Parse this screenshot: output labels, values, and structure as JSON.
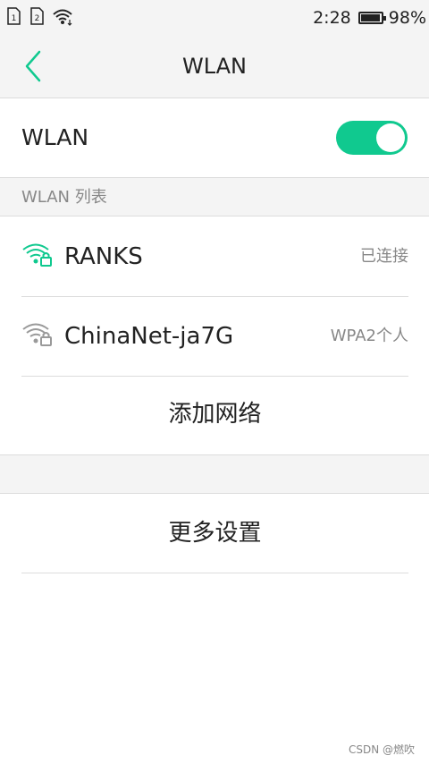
{
  "status_bar": {
    "sim1_label": "1",
    "sim2_label": "2",
    "time": "2:28",
    "battery_percent": "98%",
    "battery_level": 0.98
  },
  "header": {
    "title": "WLAN"
  },
  "wlan_toggle": {
    "label": "WLAN",
    "enabled": true
  },
  "list_section": {
    "title": "WLAN 列表"
  },
  "networks": [
    {
      "ssid": "RANKS",
      "status": "已连接",
      "connected": true
    },
    {
      "ssid": "ChinaNet-ja7G",
      "status": "WPA2个人",
      "connected": false
    }
  ],
  "actions": {
    "add_network": "添加网络",
    "more_settings": "更多设置"
  },
  "watermark": "CSDN @燃吹",
  "colors": {
    "accent": "#10c98f",
    "background": "#ffffff",
    "header_bg": "#f4f4f4"
  }
}
